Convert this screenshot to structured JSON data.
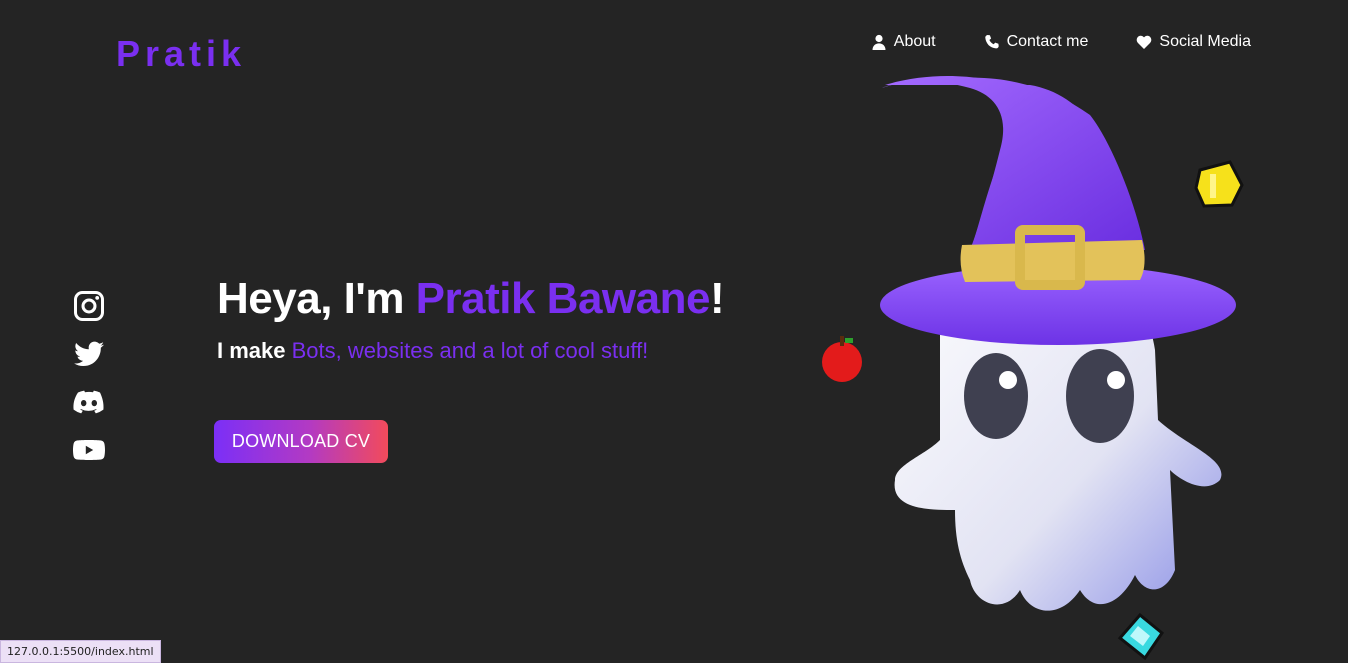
{
  "brand": {
    "logo_text": "Pratik"
  },
  "nav": {
    "about": {
      "label": "About",
      "icon": "user-icon"
    },
    "contact": {
      "label": "Contact me",
      "icon": "phone-icon"
    },
    "social": {
      "label": "Social Media",
      "icon": "heart-icon"
    }
  },
  "socials": [
    "instagram-icon",
    "twitter-icon",
    "discord-icon",
    "youtube-icon"
  ],
  "hero": {
    "greeting": "Heya, I'm ",
    "name": "Pratik Bawane",
    "exclaim": "!",
    "lead": "I make ",
    "tagline": "Bots, websites and a lot of cool stuff!",
    "cta_label": "DOWNLOAD CV"
  },
  "colors": {
    "accent": "#7a2ff0",
    "background": "#242424",
    "cta_from": "#7b2ff7",
    "cta_to": "#f24b5b"
  },
  "statusbar": {
    "url": "127.0.0.1:5500/index.html"
  }
}
